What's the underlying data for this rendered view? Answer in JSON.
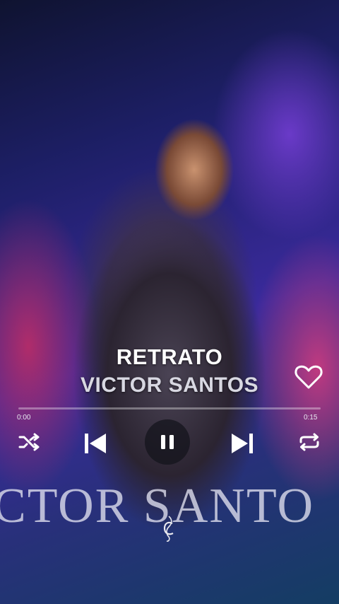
{
  "song": {
    "title": "RETRATO",
    "artist": "VICTOR SANTOS"
  },
  "video_watermark": "CTOR SANTO",
  "player": {
    "current_time": "0:00",
    "duration": "0:15",
    "progress": 0.0,
    "liked": false,
    "is_playing": true
  },
  "controls": {
    "shuffle_icon": "shuffle-icon",
    "prev_icon": "skip-previous-icon",
    "playpause_icon": "pause-icon",
    "next_icon": "skip-next-icon",
    "repeat_icon": "repeat-icon",
    "like_icon": "heart-outline-icon"
  },
  "colors": {
    "text": "#ffffff",
    "artist": "#d8d8e2",
    "button_bg": "#14141c"
  }
}
